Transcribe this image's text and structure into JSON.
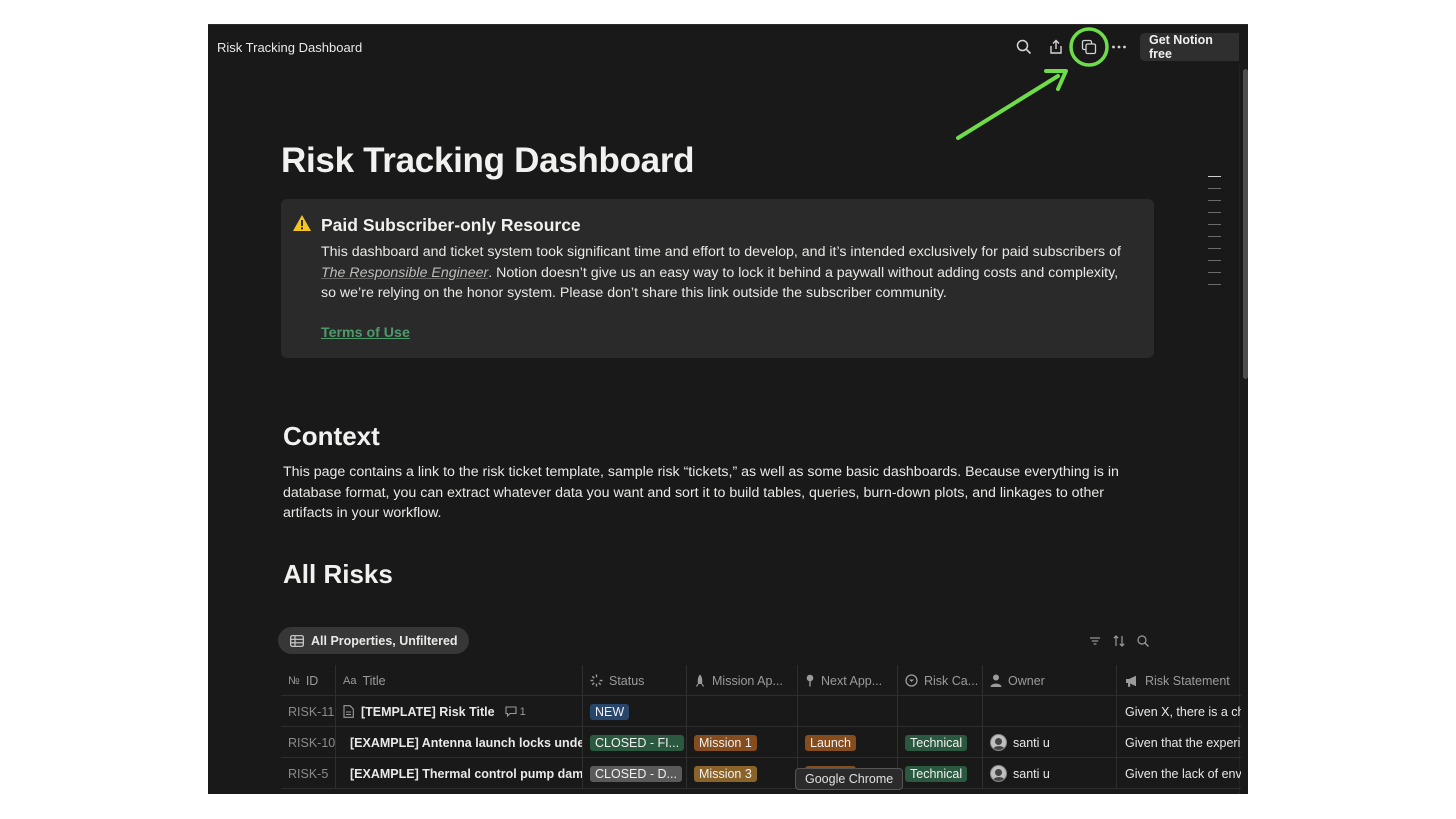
{
  "topbar": {
    "page_name": "Risk Tracking Dashboard",
    "get_notion_label": "Get Notion free",
    "icons": [
      "search-icon",
      "share-icon",
      "duplicate-icon",
      "more-icon"
    ]
  },
  "page": {
    "title": "Risk Tracking Dashboard"
  },
  "callout": {
    "icon": "warning-icon",
    "heading": "Paid Subscriber-only Resource",
    "body_before": "This dashboard and ticket system took significant time and effort to develop, and it’s intended exclusively for paid subscribers of ",
    "publication": "The Responsible Engineer",
    "body_after": ". Notion doesn’t give us an easy way to lock it behind a paywall without adding costs and complexity, so we’re relying on the honor system. Please don’t share this link outside the subscriber community.",
    "link": "Terms of Use"
  },
  "context": {
    "heading": "Context",
    "body": "This page contains a link to the risk ticket template, sample risk “tickets,” as well as some basic dashboards. Because everything is in database format, you can extract whatever data you want and sort it to build tables, queries, burn-down plots, and linkages to other artifacts in your workflow."
  },
  "all_risks": {
    "heading": "All Risks",
    "view_label": "All Properties, Unfiltered",
    "columns": {
      "id": "ID",
      "title": "Title",
      "status": "Status",
      "mission": "Mission Ap...",
      "next": "Next App...",
      "category": "Risk Ca...",
      "owner": "Owner",
      "statement": "Risk Statement"
    },
    "rows": [
      {
        "id": "RISK-11",
        "title": "[TEMPLATE] Risk Title",
        "comments": "1",
        "status": "NEW",
        "status_color": "#28456c",
        "mission": "",
        "next": "",
        "category": "",
        "owner": "",
        "statement": "Given X, there is a ch"
      },
      {
        "id": "RISK-10",
        "title": "[EXAMPLE] Antenna launch locks unde",
        "comments": "",
        "status": "CLOSED - FI...",
        "status_color": "#2b593f",
        "mission": "Mission 1",
        "mission_color": "#854c1d",
        "next": "Launch",
        "next_color": "#854c1d",
        "category": "Technical",
        "category_color": "#2b593f",
        "owner": "santi u",
        "statement": "Given that the experi"
      },
      {
        "id": "RISK-5",
        "title": "[EXAMPLE] Thermal control pump dam",
        "comments": "",
        "status": "CLOSED - D...",
        "status_color": "#5a5a5a",
        "mission": "Mission 3",
        "mission_color": "#89632a",
        "next": "",
        "next_color": "#854c1d",
        "category": "Technical",
        "category_color": "#2b593f",
        "owner": "santi u",
        "statement": "Given the lack of env"
      }
    ]
  },
  "tooltip": "Google Chrome",
  "colors": {
    "annotation": "#6fdc4a",
    "background": "#191919"
  }
}
